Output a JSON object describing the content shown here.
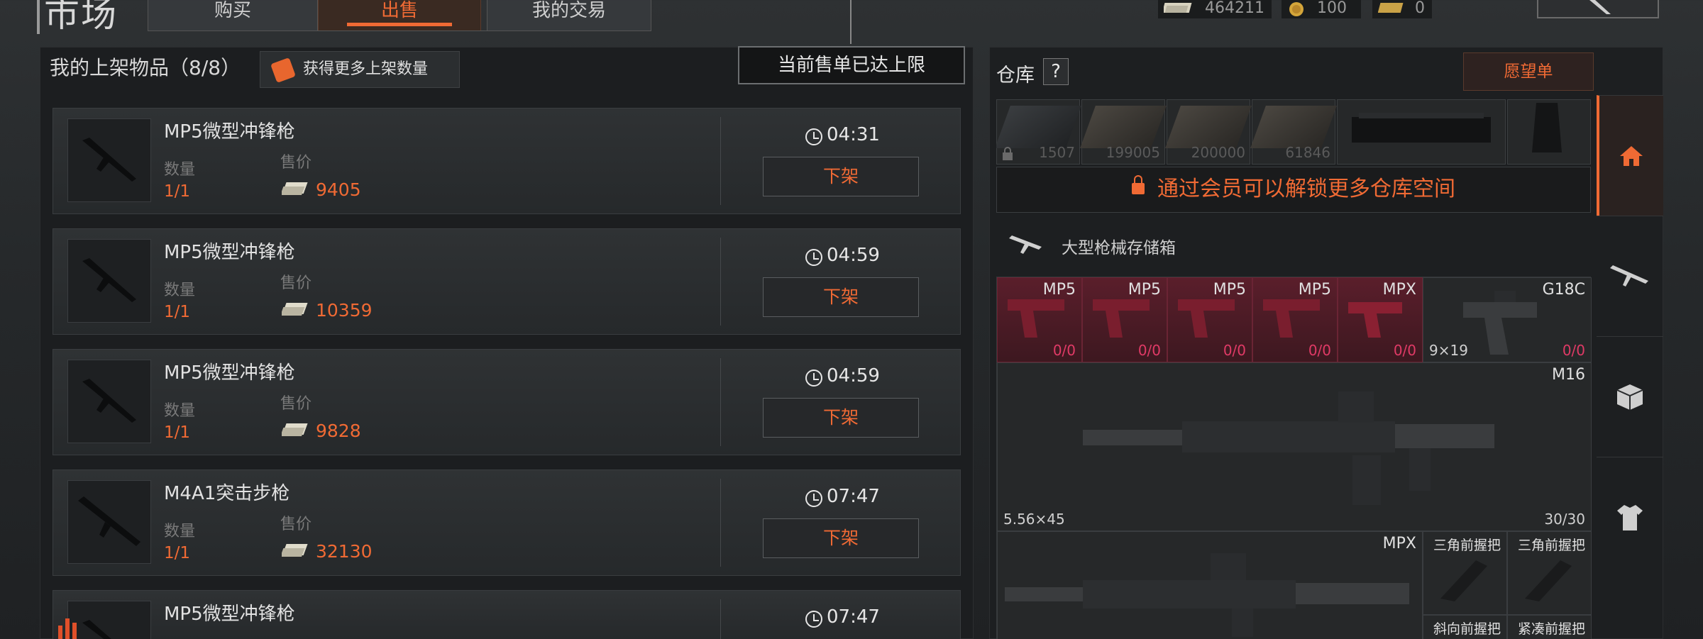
{
  "header": {
    "title": "市场",
    "tabs": [
      {
        "label": "购买",
        "active": false
      },
      {
        "label": "出售",
        "active": true
      },
      {
        "label": "我的交易",
        "active": false
      }
    ],
    "currencies": [
      {
        "icon": "cash-icon",
        "value": "464211"
      },
      {
        "icon": "coin-icon",
        "value": "100"
      },
      {
        "icon": "gold-cash-icon",
        "value": "0"
      }
    ]
  },
  "listings": {
    "title": "我的上架物品（8/8）",
    "more_button": "获得更多上架数量",
    "limit_notice": "当前售单已达上限",
    "qty_label": "数量",
    "price_label": "售价",
    "delist_label": "下架",
    "items": [
      {
        "name": "MP5微型冲锋枪",
        "qty": "1/1",
        "price": "9405",
        "time": "04:31"
      },
      {
        "name": "MP5微型冲锋枪",
        "qty": "1/1",
        "price": "10359",
        "time": "04:59"
      },
      {
        "name": "MP5微型冲锋枪",
        "qty": "1/1",
        "price": "9828",
        "time": "04:59"
      },
      {
        "name": "M4A1突击步枪",
        "qty": "1/1",
        "price": "32130",
        "time": "07:47"
      },
      {
        "name": "MP5微型冲锋枪",
        "qty": "",
        "price": "",
        "time": "07:47"
      }
    ]
  },
  "warehouse": {
    "title": "仓库",
    "help": "?",
    "wishlist": "愿望单",
    "top_slots": [
      "1507",
      "199005",
      "200000",
      "61846",
      "",
      ""
    ],
    "unlock_text": "通过会员可以解锁更多仓库空间",
    "case_title": "大型枪械存储箱",
    "pistol_slots": [
      {
        "label": "MP5",
        "count": "0/0"
      },
      {
        "label": "MP5",
        "count": "0/0"
      },
      {
        "label": "MP5",
        "count": "0/0"
      },
      {
        "label": "MP5",
        "count": "0/0"
      },
      {
        "label": "MPX",
        "count": "0/0"
      },
      {
        "label": "G18C",
        "caliber": "9×19",
        "count": "0/0"
      }
    ],
    "m16": {
      "label": "M16",
      "caliber": "5.56×45",
      "count": "30/30"
    },
    "mpx": {
      "label": "MPX"
    },
    "attachments": [
      "三角前握把",
      "三角前握把",
      "斜向前握把",
      "紧凑前握把"
    ]
  },
  "sidebar": [
    "home-icon",
    "rifle-icon",
    "box-icon",
    "shirt-icon"
  ],
  "colors": {
    "accent": "#f06a34",
    "bg": "#1c1e20",
    "slot_red": "#5a1e2b",
    "count_red": "#e03a66"
  }
}
